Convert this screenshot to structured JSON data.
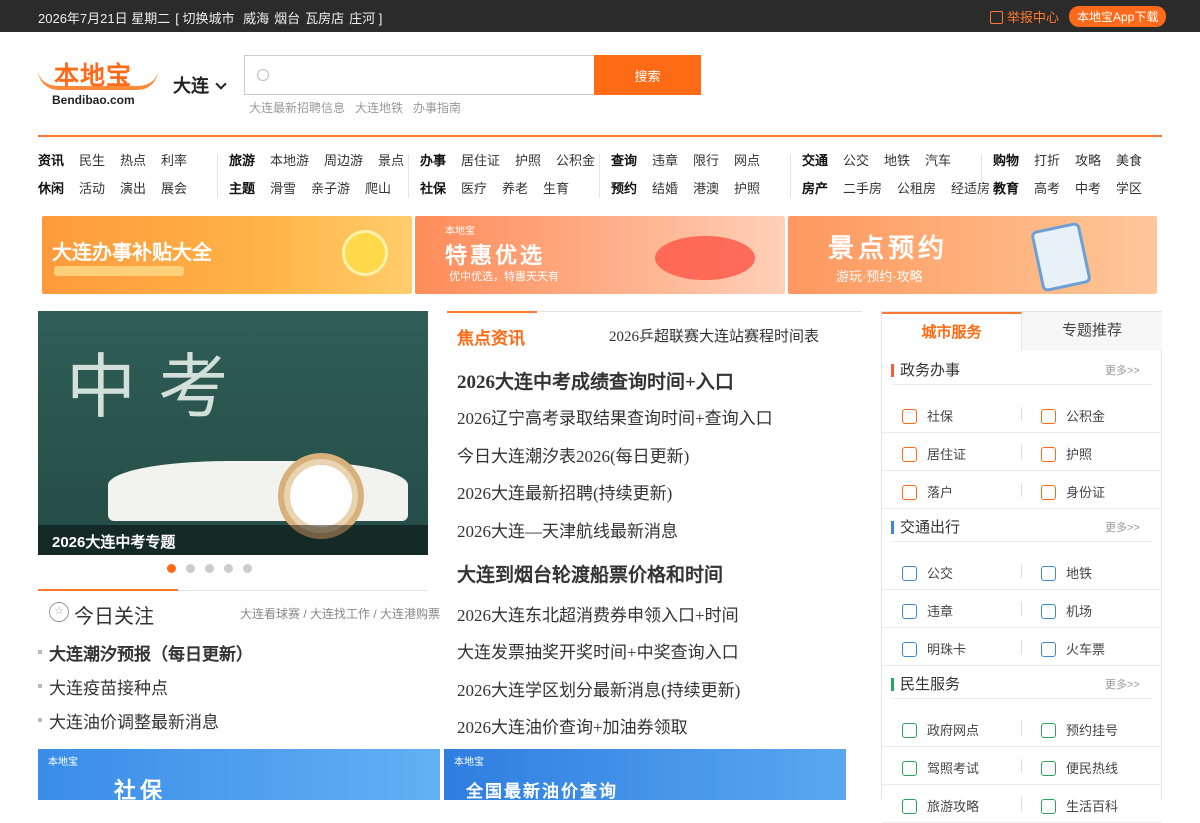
{
  "topbar": {
    "date": "2026年7月21日 星期二",
    "switch_text": "[ 切换城市",
    "cities": [
      "威海",
      "烟台",
      "瓦房店",
      "庄河 ]"
    ],
    "report": "举报中心",
    "app_download": "本地宝App下载"
  },
  "header": {
    "logo_cn": "本地宝",
    "logo_en": "Bendibao.com",
    "city": "大连",
    "search_button": "搜索",
    "search_value": "",
    "hotwords": [
      "大连最新招聘信息",
      "大连地铁",
      "办事指南"
    ]
  },
  "nav": [
    {
      "row1": {
        "cat": "资讯",
        "items": [
          "民生",
          "热点",
          "利率"
        ]
      },
      "row2": {
        "cat": "休闲",
        "items": [
          "活动",
          "演出",
          "展会"
        ]
      }
    },
    {
      "row1": {
        "cat": "旅游",
        "items": [
          "本地游",
          "周边游",
          "景点"
        ]
      },
      "row2": {
        "cat": "主题",
        "items": [
          "滑雪",
          "亲子游",
          "爬山"
        ]
      }
    },
    {
      "row1": {
        "cat": "办事",
        "items": [
          "居住证",
          "护照",
          "公积金"
        ]
      },
      "row2": {
        "cat": "社保",
        "items": [
          "医疗",
          "养老",
          "生育"
        ]
      }
    },
    {
      "row1": {
        "cat": "查询",
        "items": [
          "违章",
          "限行",
          "网点"
        ]
      },
      "row2": {
        "cat": "预约",
        "items": [
          "结婚",
          "港澳",
          "护照"
        ]
      }
    },
    {
      "row1": {
        "cat": "交通",
        "items": [
          "公交",
          "地铁",
          "汽车"
        ]
      },
      "row2": {
        "cat": "房产",
        "items": [
          "二手房",
          "公租房",
          "经适房"
        ]
      }
    },
    {
      "row1": {
        "cat": "购物",
        "items": [
          "打折",
          "攻略",
          "美食"
        ]
      },
      "row2": {
        "cat": "教育",
        "items": [
          "高考",
          "中考",
          "学区"
        ]
      }
    }
  ],
  "banners": {
    "b1": "大连办事补贴大全",
    "b2_logo": "本地宝",
    "b2": "特惠优选",
    "b2_sub": "优中优选，特惠天天有",
    "b3": "景点预约",
    "b3_sub": "游玩·预约·攻略"
  },
  "slider": {
    "caption": "2026大连中考专题",
    "dots": 5,
    "active_dot": 0
  },
  "today": {
    "title": "今日关注",
    "links": "大连看球赛 / 大连找工作 / 大连港购票",
    "items": [
      "大连潮汐预报（每日更新）",
      "大连疫苗接种点",
      "大连油价调整最新消息"
    ]
  },
  "news": {
    "tab": "焦点资讯",
    "sub": "2026乒超联赛大连站赛程时间表",
    "items": [
      "2026大连中考成绩查询时间+入口",
      "2026辽宁高考录取结果查询时间+查询入口",
      "今日大连潮汐表2026(每日更新)",
      "2026大连最新招聘(持续更新)",
      "2026大连—天津航线最新消息",
      "大连到烟台轮渡船票价格和时间",
      "2026大连东北超消费券申领入口+时间",
      "大连发票抽奖开奖时间+中奖查询入口",
      "2026大连学区划分最新消息(持续更新)",
      "2026大连油价查询+加油券领取"
    ]
  },
  "services": {
    "tab_active": "城市服务",
    "tab_other": "专题推荐",
    "more": "更多>>",
    "sections": [
      {
        "title": "政务办事",
        "color": "#ff5a3a",
        "rows": [
          [
            "社保",
            "公积金"
          ],
          [
            "居住证",
            "护照"
          ],
          [
            "落户",
            "身份证"
          ]
        ]
      },
      {
        "title": "交通出行",
        "color": "#3a8ad8",
        "rows": [
          [
            "公交",
            "地铁"
          ],
          [
            "违章",
            "机场"
          ],
          [
            "明珠卡",
            "火车票"
          ]
        ]
      },
      {
        "title": "民生服务",
        "color": "#2aa55f",
        "rows": [
          [
            "政府网点",
            "预约挂号"
          ],
          [
            "驾照考试",
            "便民热线"
          ],
          [
            "旅游攻略",
            "生活百科"
          ]
        ]
      }
    ]
  },
  "bottom_banners": {
    "logo": "本地宝",
    "b1": "社保",
    "b2": "全国最新油价查询"
  }
}
